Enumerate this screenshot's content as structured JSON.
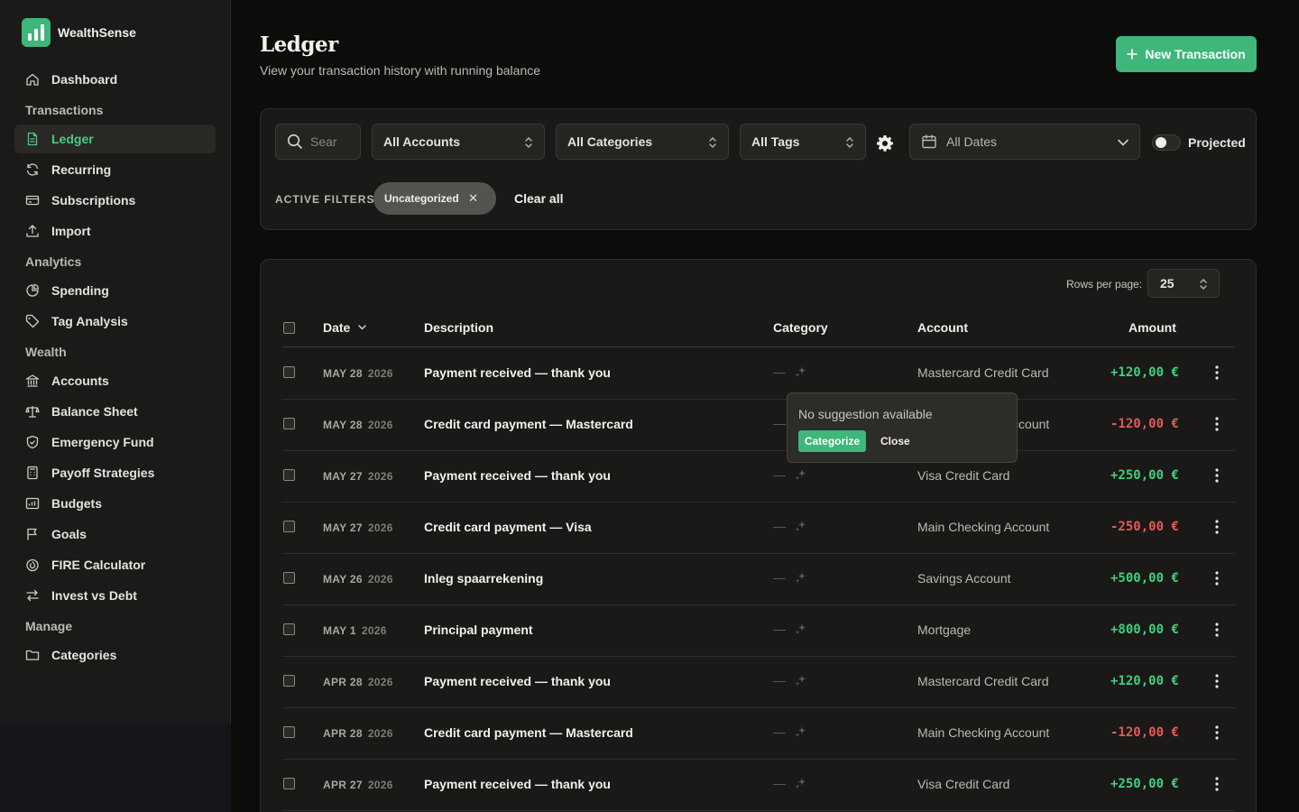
{
  "app": {
    "name": "WealthSense"
  },
  "sidebar": {
    "items": [
      {
        "type": "item",
        "label": "Dashboard",
        "icon": "home-icon"
      },
      {
        "type": "section",
        "label": "Transactions"
      },
      {
        "type": "item",
        "label": "Ledger",
        "icon": "document-icon",
        "active": true
      },
      {
        "type": "item",
        "label": "Recurring",
        "icon": "refresh-icon"
      },
      {
        "type": "item",
        "label": "Subscriptions",
        "icon": "card-icon"
      },
      {
        "type": "item",
        "label": "Import",
        "icon": "upload-icon"
      },
      {
        "type": "section",
        "label": "Analytics"
      },
      {
        "type": "item",
        "label": "Spending",
        "icon": "pie-chart-icon"
      },
      {
        "type": "item",
        "label": "Tag Analysis",
        "icon": "tag-icon"
      },
      {
        "type": "section",
        "label": "Wealth"
      },
      {
        "type": "item",
        "label": "Accounts",
        "icon": "bank-icon"
      },
      {
        "type": "item",
        "label": "Balance Sheet",
        "icon": "scale-icon"
      },
      {
        "type": "item",
        "label": "Emergency Fund",
        "icon": "shield-icon"
      },
      {
        "type": "item",
        "label": "Payoff Strategies",
        "icon": "calculator-icon"
      },
      {
        "type": "item",
        "label": "Budgets",
        "icon": "budget-icon"
      },
      {
        "type": "item",
        "label": "Goals",
        "icon": "flag-icon"
      },
      {
        "type": "item",
        "label": "FIRE Calculator",
        "icon": "flame-icon"
      },
      {
        "type": "item",
        "label": "Invest vs Debt",
        "icon": "swap-icon"
      },
      {
        "type": "section",
        "label": "Manage"
      },
      {
        "type": "item",
        "label": "Categories",
        "icon": "folder-icon"
      }
    ]
  },
  "header": {
    "title": "Ledger",
    "subtitle": "View your transaction history with running balance",
    "new_button": "New Transaction"
  },
  "filters": {
    "search_placeholder": "Search",
    "accounts": "All Accounts",
    "categories": "All Categories",
    "tags": "All Tags",
    "dates": "All Dates",
    "projected_label": "Projected",
    "active_label": "ACTIVE FILTERS:",
    "active_chip": "Uncategorized",
    "clear_all": "Clear all"
  },
  "table": {
    "rows_per_page_label": "Rows per page:",
    "rows_per_page": "25",
    "columns": {
      "date": "Date",
      "description": "Description",
      "category": "Category",
      "account": "Account",
      "amount": "Amount"
    },
    "rows": [
      {
        "date": "MAY 28",
        "year": "2026",
        "description": "Payment received — thank you",
        "category": "—",
        "account": "Mastercard Credit Card",
        "amount": "+120,00 €",
        "sign": "pos"
      },
      {
        "date": "MAY 28",
        "year": "2026",
        "description": "Credit card payment — Mastercard",
        "category": "—",
        "account": "Main Checking Account",
        "amount": "-120,00 €",
        "sign": "neg"
      },
      {
        "date": "MAY 27",
        "year": "2026",
        "description": "Payment received — thank you",
        "category": "—",
        "account": "Visa Credit Card",
        "amount": "+250,00 €",
        "sign": "pos"
      },
      {
        "date": "MAY 27",
        "year": "2026",
        "description": "Credit card payment — Visa",
        "category": "—",
        "account": "Main Checking Account",
        "amount": "-250,00 €",
        "sign": "neg"
      },
      {
        "date": "MAY 26",
        "year": "2026",
        "description": "Inleg spaarrekening",
        "category": "—",
        "account": "Savings Account",
        "amount": "+500,00 €",
        "sign": "pos"
      },
      {
        "date": "MAY 1",
        "year": "2026",
        "description": "Principal payment",
        "category": "—",
        "account": "Mortgage",
        "amount": "+800,00 €",
        "sign": "pos"
      },
      {
        "date": "APR 28",
        "year": "2026",
        "description": "Payment received — thank you",
        "category": "—",
        "account": "Mastercard Credit Card",
        "amount": "+120,00 €",
        "sign": "pos"
      },
      {
        "date": "APR 28",
        "year": "2026",
        "description": "Credit card payment — Mastercard",
        "category": "—",
        "account": "Main Checking Account",
        "amount": "-120,00 €",
        "sign": "neg"
      },
      {
        "date": "APR 27",
        "year": "2026",
        "description": "Payment received — thank you",
        "category": "—",
        "account": "Visa Credit Card",
        "amount": "+250,00 €",
        "sign": "pos"
      }
    ]
  },
  "popover": {
    "message": "No suggestion available",
    "categorize": "Categorize",
    "close": "Close"
  },
  "colors": {
    "accent": "#3fb67a",
    "positive": "#3fd07d",
    "negative": "#e25b57"
  }
}
